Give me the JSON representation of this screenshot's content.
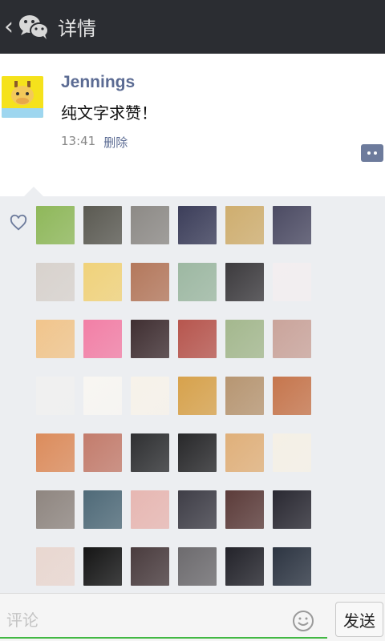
{
  "header": {
    "back_symbol": "‹",
    "title": "详情",
    "logo_icon": "wechat-icon"
  },
  "post": {
    "author": "Jennings",
    "text": "纯文字求赞！",
    "time": "13:41",
    "delete_label": "删除",
    "avatar_icon": "giraffe-avatar-icon",
    "comment_button_icon": "comment-dots-icon"
  },
  "likes": {
    "icon": "heart-icon",
    "avatar_count": 42,
    "avatar_colors": [
      "#8fb85a",
      "#5b5a52",
      "#8d8a86",
      "#3c3e5a",
      "#cfae6f",
      "#4c4b63",
      "#d8d2cd",
      "#f0d27a",
      "#b4785c",
      "#9db8a2",
      "#3d3b3e",
      "#f3eef0",
      "#f1c58c",
      "#f27fa6",
      "#402f32",
      "#b7564e",
      "#a4b88e",
      "#caa49b",
      "#f0f0f0",
      "#f8f6f2",
      "#f7f2ea",
      "#d7a24c",
      "#b79672",
      "#c6764d",
      "#dc8c5c",
      "#c37c6c",
      "#2f3032",
      "#28282a",
      "#e0b07a",
      "#f5f0e6",
      "#8f8680",
      "#4f6a78",
      "#e7b7b2",
      "#3f3e47",
      "#5c3c3a",
      "#2a2932",
      "#e9d7d0",
      "#151515",
      "#4a3c3e",
      "#6d6b6e",
      "#23232a",
      "#2d3542"
    ]
  },
  "input": {
    "placeholder": "评论",
    "emoji_icon": "smiley-icon",
    "send_label": "发送"
  }
}
